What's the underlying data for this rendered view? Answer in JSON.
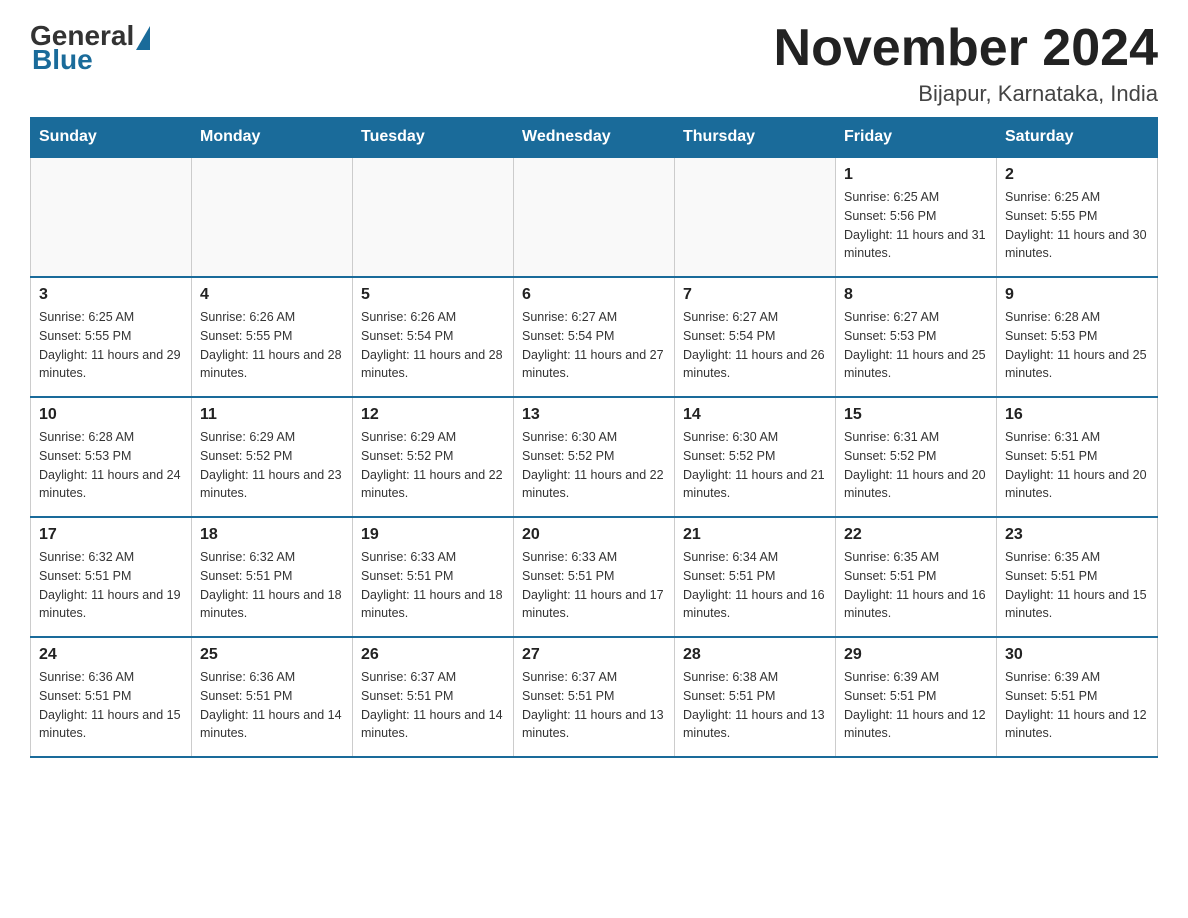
{
  "header": {
    "logo_general": "General",
    "logo_blue": "Blue",
    "title": "November 2024",
    "subtitle": "Bijapur, Karnataka, India"
  },
  "days_of_week": [
    "Sunday",
    "Monday",
    "Tuesday",
    "Wednesday",
    "Thursday",
    "Friday",
    "Saturday"
  ],
  "weeks": [
    [
      {
        "day": "",
        "info": ""
      },
      {
        "day": "",
        "info": ""
      },
      {
        "day": "",
        "info": ""
      },
      {
        "day": "",
        "info": ""
      },
      {
        "day": "",
        "info": ""
      },
      {
        "day": "1",
        "info": "Sunrise: 6:25 AM\nSunset: 5:56 PM\nDaylight: 11 hours and 31 minutes."
      },
      {
        "day": "2",
        "info": "Sunrise: 6:25 AM\nSunset: 5:55 PM\nDaylight: 11 hours and 30 minutes."
      }
    ],
    [
      {
        "day": "3",
        "info": "Sunrise: 6:25 AM\nSunset: 5:55 PM\nDaylight: 11 hours and 29 minutes."
      },
      {
        "day": "4",
        "info": "Sunrise: 6:26 AM\nSunset: 5:55 PM\nDaylight: 11 hours and 28 minutes."
      },
      {
        "day": "5",
        "info": "Sunrise: 6:26 AM\nSunset: 5:54 PM\nDaylight: 11 hours and 28 minutes."
      },
      {
        "day": "6",
        "info": "Sunrise: 6:27 AM\nSunset: 5:54 PM\nDaylight: 11 hours and 27 minutes."
      },
      {
        "day": "7",
        "info": "Sunrise: 6:27 AM\nSunset: 5:54 PM\nDaylight: 11 hours and 26 minutes."
      },
      {
        "day": "8",
        "info": "Sunrise: 6:27 AM\nSunset: 5:53 PM\nDaylight: 11 hours and 25 minutes."
      },
      {
        "day": "9",
        "info": "Sunrise: 6:28 AM\nSunset: 5:53 PM\nDaylight: 11 hours and 25 minutes."
      }
    ],
    [
      {
        "day": "10",
        "info": "Sunrise: 6:28 AM\nSunset: 5:53 PM\nDaylight: 11 hours and 24 minutes."
      },
      {
        "day": "11",
        "info": "Sunrise: 6:29 AM\nSunset: 5:52 PM\nDaylight: 11 hours and 23 minutes."
      },
      {
        "day": "12",
        "info": "Sunrise: 6:29 AM\nSunset: 5:52 PM\nDaylight: 11 hours and 22 minutes."
      },
      {
        "day": "13",
        "info": "Sunrise: 6:30 AM\nSunset: 5:52 PM\nDaylight: 11 hours and 22 minutes."
      },
      {
        "day": "14",
        "info": "Sunrise: 6:30 AM\nSunset: 5:52 PM\nDaylight: 11 hours and 21 minutes."
      },
      {
        "day": "15",
        "info": "Sunrise: 6:31 AM\nSunset: 5:52 PM\nDaylight: 11 hours and 20 minutes."
      },
      {
        "day": "16",
        "info": "Sunrise: 6:31 AM\nSunset: 5:51 PM\nDaylight: 11 hours and 20 minutes."
      }
    ],
    [
      {
        "day": "17",
        "info": "Sunrise: 6:32 AM\nSunset: 5:51 PM\nDaylight: 11 hours and 19 minutes."
      },
      {
        "day": "18",
        "info": "Sunrise: 6:32 AM\nSunset: 5:51 PM\nDaylight: 11 hours and 18 minutes."
      },
      {
        "day": "19",
        "info": "Sunrise: 6:33 AM\nSunset: 5:51 PM\nDaylight: 11 hours and 18 minutes."
      },
      {
        "day": "20",
        "info": "Sunrise: 6:33 AM\nSunset: 5:51 PM\nDaylight: 11 hours and 17 minutes."
      },
      {
        "day": "21",
        "info": "Sunrise: 6:34 AM\nSunset: 5:51 PM\nDaylight: 11 hours and 16 minutes."
      },
      {
        "day": "22",
        "info": "Sunrise: 6:35 AM\nSunset: 5:51 PM\nDaylight: 11 hours and 16 minutes."
      },
      {
        "day": "23",
        "info": "Sunrise: 6:35 AM\nSunset: 5:51 PM\nDaylight: 11 hours and 15 minutes."
      }
    ],
    [
      {
        "day": "24",
        "info": "Sunrise: 6:36 AM\nSunset: 5:51 PM\nDaylight: 11 hours and 15 minutes."
      },
      {
        "day": "25",
        "info": "Sunrise: 6:36 AM\nSunset: 5:51 PM\nDaylight: 11 hours and 14 minutes."
      },
      {
        "day": "26",
        "info": "Sunrise: 6:37 AM\nSunset: 5:51 PM\nDaylight: 11 hours and 14 minutes."
      },
      {
        "day": "27",
        "info": "Sunrise: 6:37 AM\nSunset: 5:51 PM\nDaylight: 11 hours and 13 minutes."
      },
      {
        "day": "28",
        "info": "Sunrise: 6:38 AM\nSunset: 5:51 PM\nDaylight: 11 hours and 13 minutes."
      },
      {
        "day": "29",
        "info": "Sunrise: 6:39 AM\nSunset: 5:51 PM\nDaylight: 11 hours and 12 minutes."
      },
      {
        "day": "30",
        "info": "Sunrise: 6:39 AM\nSunset: 5:51 PM\nDaylight: 11 hours and 12 minutes."
      }
    ]
  ]
}
